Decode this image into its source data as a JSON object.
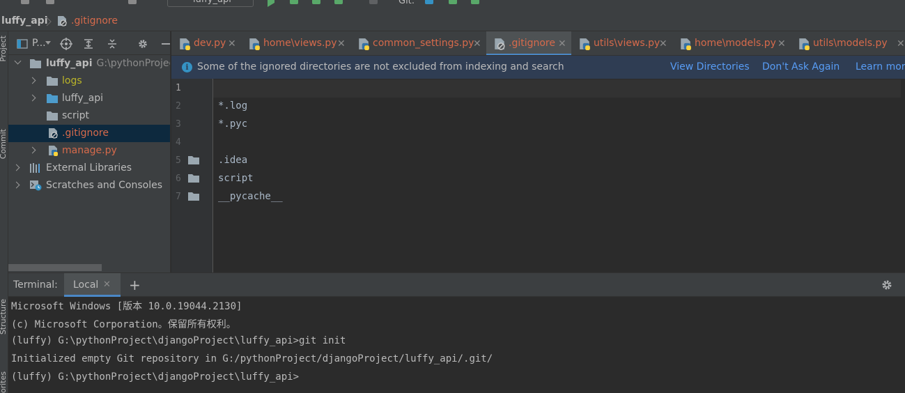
{
  "toolbar": {
    "run_config": "luffy_api",
    "git_label": "Git:"
  },
  "navbar": {
    "project": "luffy_api",
    "file": ".gitignore"
  },
  "left_strip": {
    "project_label": "Project",
    "commit_label": "Commit",
    "structure_label": "Structure",
    "favorites_label": "Favorites"
  },
  "project_panel": {
    "title": "P...",
    "tree": [
      {
        "label": "luffy_api",
        "path": "G:\\pythonProject\\djangoProject\\luffy_api",
        "expanded": true,
        "type": "folder"
      },
      {
        "label": "logs",
        "type": "folder",
        "color": "#bbb529"
      },
      {
        "label": "luffy_api",
        "type": "package"
      },
      {
        "label": "script",
        "type": "folder"
      },
      {
        "label": ".gitignore",
        "type": "file",
        "color": "#d66a4b",
        "selected": true
      },
      {
        "label": "manage.py",
        "type": "python",
        "color": "#d66a4b"
      },
      {
        "label": "External Libraries",
        "type": "libraries"
      },
      {
        "label": "Scratches and Consoles",
        "type": "scratches"
      }
    ]
  },
  "editor_tabs": [
    {
      "label": "dev.py",
      "active": false
    },
    {
      "label": "home\\views.py",
      "active": false
    },
    {
      "label": "common_settings.py",
      "active": false
    },
    {
      "label": ".gitignore",
      "active": true
    },
    {
      "label": "utils\\views.py",
      "active": false
    },
    {
      "label": "home\\models.py",
      "active": false
    },
    {
      "label": "utils\\models.py",
      "active": false
    }
  ],
  "notice": {
    "message": "Some of the ignored directories are not excluded from indexing and search",
    "view_directories": "View Directories",
    "dont_ask": "Don't Ask Again",
    "learn_more": "Learn more"
  },
  "editor": {
    "lines": [
      {
        "num": "1",
        "text": "",
        "folder": false
      },
      {
        "num": "2",
        "text": "*.log",
        "folder": false
      },
      {
        "num": "3",
        "text": "*.pyc",
        "folder": false
      },
      {
        "num": "4",
        "text": "",
        "folder": false
      },
      {
        "num": "5",
        "text": ".idea",
        "folder": true
      },
      {
        "num": "6",
        "text": "script",
        "folder": true
      },
      {
        "num": "7",
        "text": "__pycache__",
        "folder": true
      }
    ]
  },
  "terminal": {
    "title": "Terminal:",
    "tab": "Local",
    "lines": [
      "Microsoft Windows [版本 10.0.19044.2130]",
      "(c) Microsoft Corporation。保留所有权利。",
      "(luffy) G:\\pythonProject\\djangoProject\\luffy_api>git init",
      "Initialized empty Git repository in G:/pythonProject/djangoProject/luffy_api/.git/",
      "(luffy) G:\\pythonProject\\djangoProject\\luffy_api>"
    ]
  },
  "colors": {
    "accent": "#4a88c7",
    "ignored_file": "#d66a4b",
    "link": "#589df6",
    "notice_bg": "#2f3d53"
  }
}
